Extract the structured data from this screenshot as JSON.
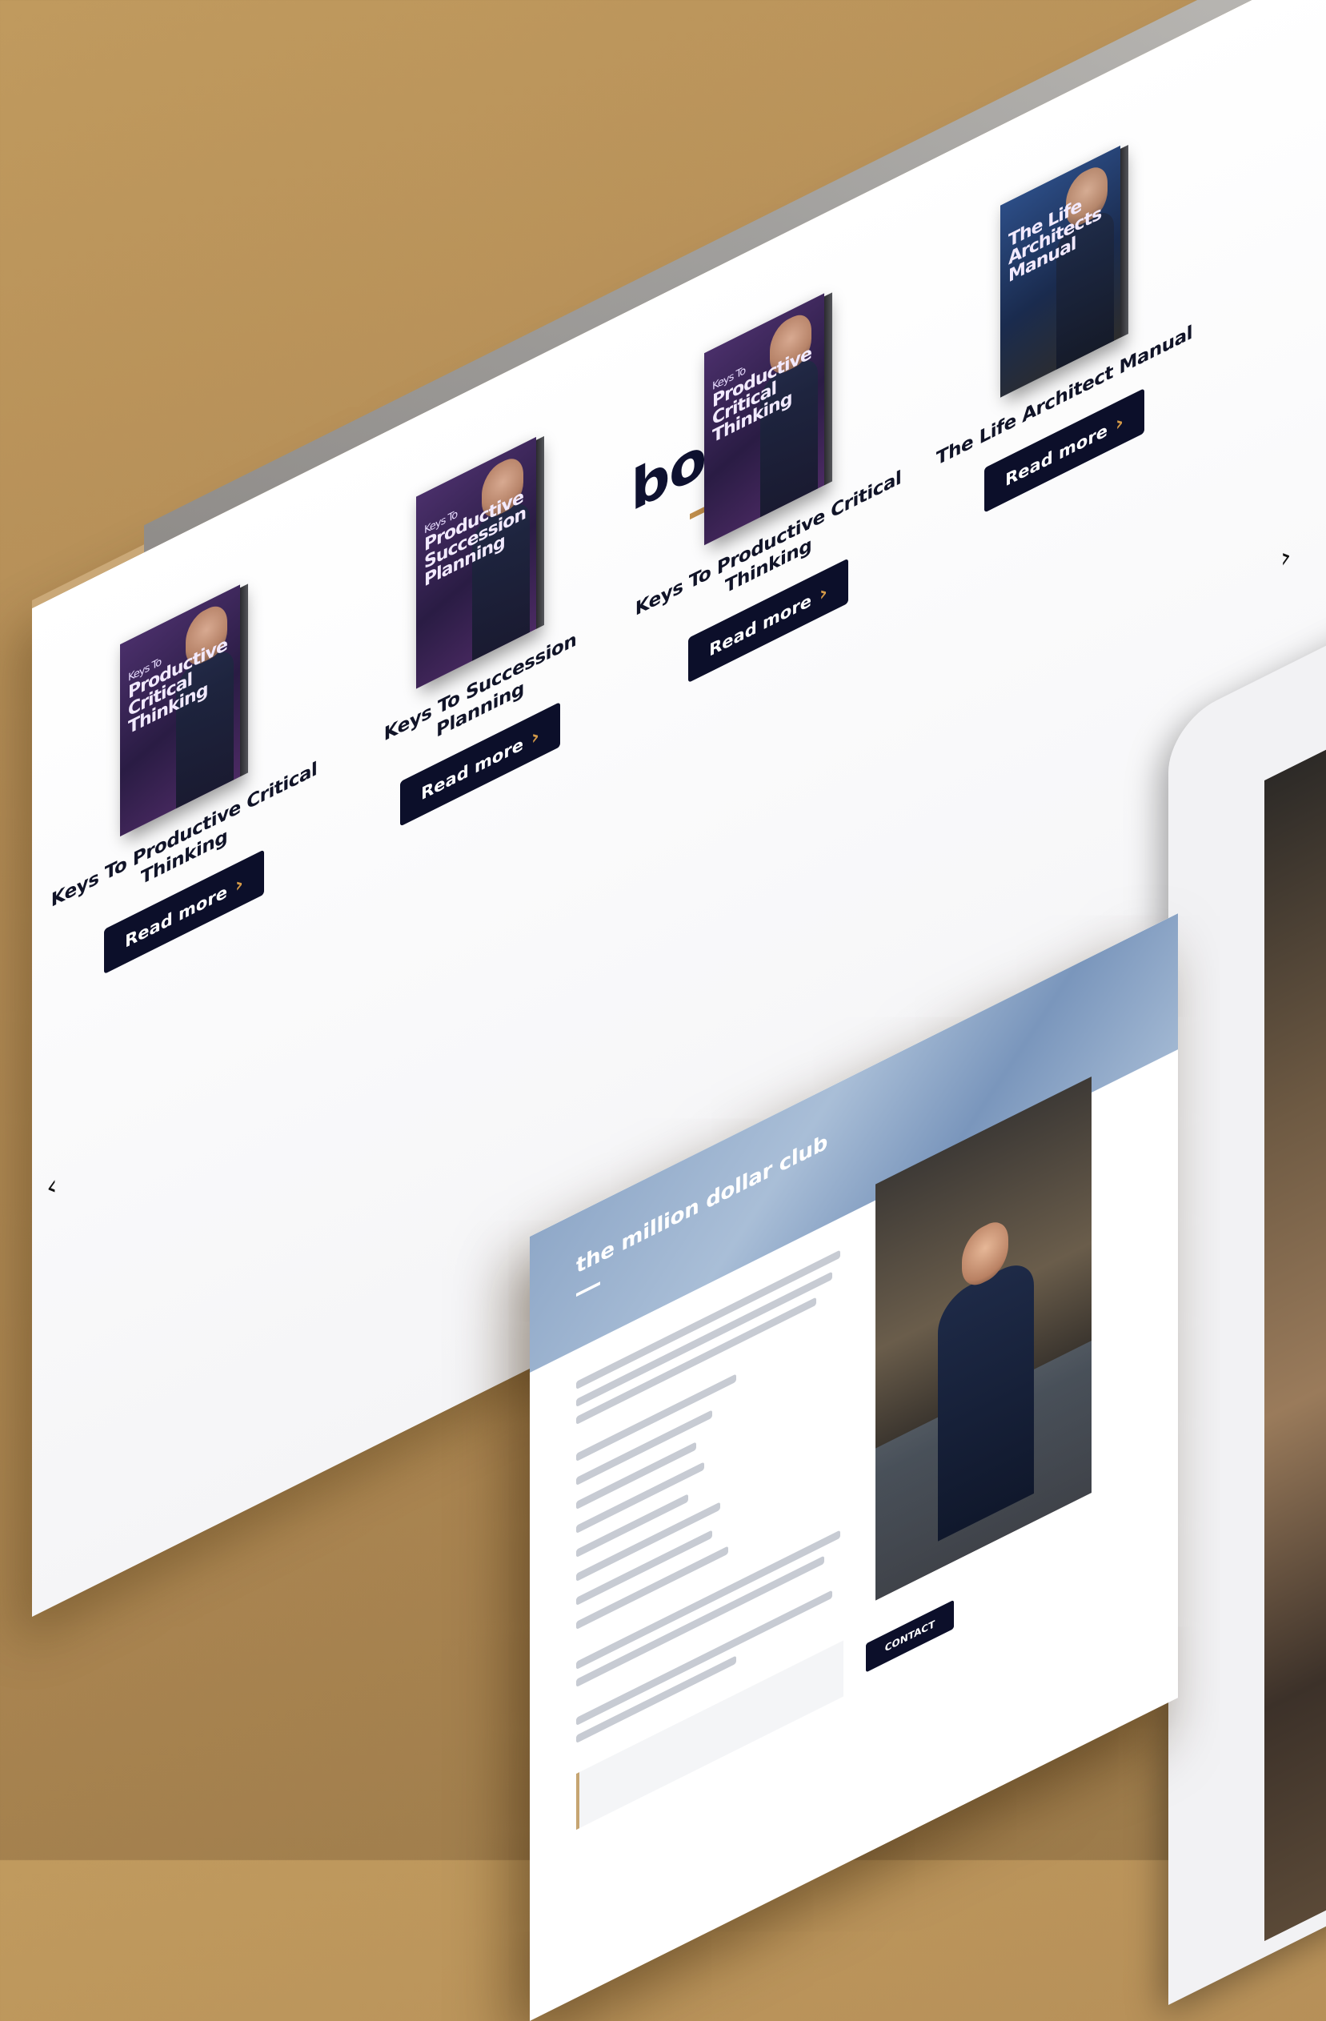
{
  "books_section": {
    "title": "books",
    "prev_icon": "chevron-left-icon",
    "next_icon": "chevron-right-icon",
    "prev_glyph": "‹",
    "next_glyph": "›",
    "items": [
      {
        "title": "Keys To Productive Critical Thinking",
        "cover_kicker": "Keys To",
        "cover_title": "Productive Critical Thinking",
        "read_more_label": "Read more",
        "read_more_icon": "chevron-right-icon",
        "cover_color": "purple"
      },
      {
        "title": "Keys To Succession Planning",
        "cover_kicker": "Keys To",
        "cover_title": "Productive Succession Planning",
        "read_more_label": "Read more",
        "read_more_icon": "chevron-right-icon",
        "cover_color": "purple"
      },
      {
        "title": "Keys To Productive Critical Thinking",
        "cover_kicker": "Keys To",
        "cover_title": "Productive Critical Thinking",
        "read_more_label": "Read more",
        "read_more_icon": "chevron-right-icon",
        "cover_color": "purple"
      },
      {
        "title": "The Life Architect Manual",
        "cover_kicker": "",
        "cover_title": "The Life Architects Manual",
        "read_more_label": "Read more",
        "read_more_icon": "chevron-right-icon",
        "cover_color": "blue"
      }
    ]
  },
  "card": {
    "heading": "the million dollar club",
    "contact_label": "CONTACT"
  },
  "colors": {
    "background": "#b48d57",
    "navy": "#0c0f2a",
    "accent": "#c08e4c",
    "hero_blue": "#8fa8c8"
  }
}
